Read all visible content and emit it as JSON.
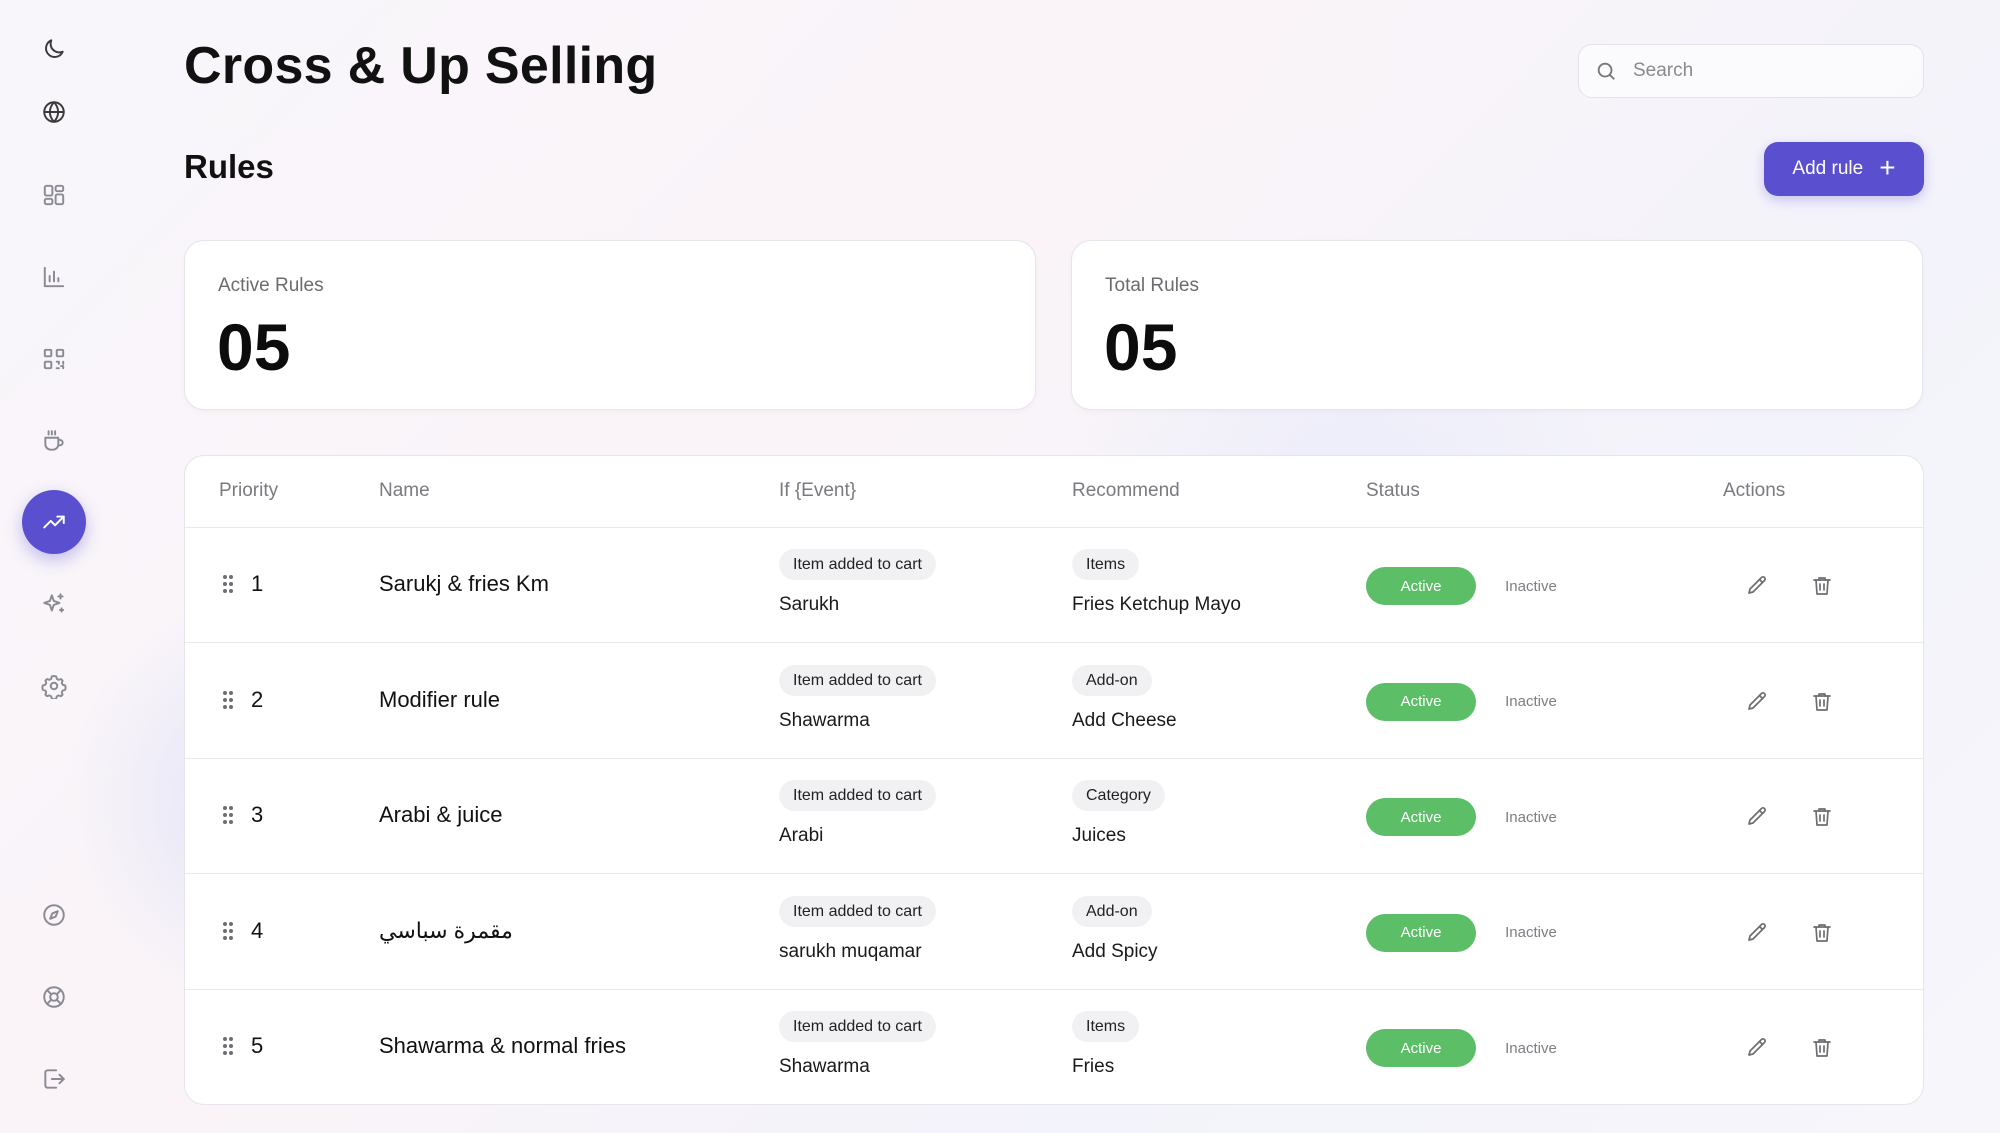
{
  "page": {
    "title": "Cross & Up Selling",
    "section_title": "Rules",
    "accent_color": "#5a4fcf",
    "active_color": "#5cbf67"
  },
  "search": {
    "placeholder": "Search",
    "value": ""
  },
  "toolbar": {
    "add_label": "Add rule",
    "add_icon": "plus-icon"
  },
  "sidebar": {
    "top_icons": [
      "moon-icon",
      "globe-icon"
    ],
    "items": [
      {
        "icon": "dashboard-icon"
      },
      {
        "icon": "bar-chart-icon"
      },
      {
        "icon": "qr-code-icon"
      },
      {
        "icon": "coffee-cup-icon"
      },
      {
        "icon": "trending-up-icon",
        "active": true
      },
      {
        "icon": "sparkles-icon"
      },
      {
        "icon": "settings-icon"
      }
    ],
    "bottom_icons": [
      "compass-icon",
      "support-icon",
      "logout-icon"
    ]
  },
  "stats": [
    {
      "label": "Active Rules",
      "value": "05"
    },
    {
      "label": "Total Rules",
      "value": "05"
    }
  ],
  "table": {
    "columns": [
      "Priority",
      "Name",
      "If {Event}",
      "Recommend",
      "Status",
      "Actions"
    ],
    "status_labels": {
      "active": "Active",
      "inactive": "Inactive"
    },
    "rows": [
      {
        "priority": "1",
        "name": "Sarukj & fries Km",
        "event": "Item added to cart",
        "event_item": "Sarukh",
        "rec_type": "Items",
        "rec_value": "Fries Ketchup Mayo",
        "status": "active"
      },
      {
        "priority": "2",
        "name": "Modifier rule",
        "event": "Item added to cart",
        "event_item": "Shawarma",
        "rec_type": "Add-on",
        "rec_value": "Add Cheese",
        "status": "active"
      },
      {
        "priority": "3",
        "name": "Arabi & juice",
        "event": "Item added to cart",
        "event_item": "Arabi",
        "rec_type": "Category",
        "rec_value": "Juices",
        "status": "active"
      },
      {
        "priority": "4",
        "name": "مقمرة سباسي",
        "event": "Item added to cart",
        "event_item": "sarukh muqamar",
        "rec_type": "Add-on",
        "rec_value": "Add Spicy",
        "status": "active"
      },
      {
        "priority": "5",
        "name": "Shawarma & normal fries",
        "event": "Item added to cart",
        "event_item": "Shawarma",
        "rec_type": "Items",
        "rec_value": "Fries",
        "status": "active"
      }
    ]
  }
}
